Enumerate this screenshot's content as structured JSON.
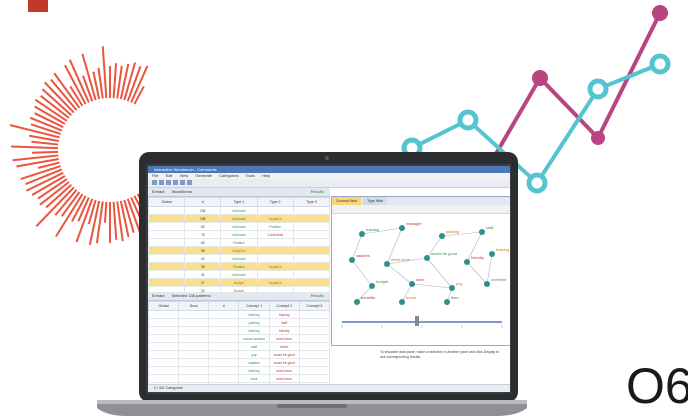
{
  "colors": {
    "accent_red": "#e9553f",
    "magenta": "#b8457f",
    "teal": "#55c4d1",
    "dash_yellow": "#f3c343",
    "corner_red": "#c0392b"
  },
  "icons": [
    "sunburst-graphic",
    "trend-line-graphic",
    "laptop-icon"
  ],
  "headline_fragment": "O6",
  "app": {
    "title": "Interactive Workbench - Comments",
    "menu": [
      "File",
      "Edit",
      "View",
      "Generate",
      "Categories",
      "Tools",
      "Help"
    ],
    "top_panel": {
      "label": "Extract",
      "field": "Word/Items",
      "run": "Results"
    },
    "top_columns": [
      "Global",
      "#",
      "Type 1",
      "Type 2",
      "Type 3"
    ],
    "top_rows": [
      {
        "g": "",
        "n": "234",
        "t1": "Unknown",
        "t2": "",
        "t3": "",
        "hl": false
      },
      {
        "g": "",
        "n": "198",
        "t1": "Unknown",
        "t2": "Negative",
        "t3": "",
        "hl": true
      },
      {
        "g": "",
        "n": "92",
        "t1": "Unknown",
        "t2": "Positive",
        "t3": "",
        "hl": false
      },
      {
        "g": "",
        "n": "75",
        "t1": "Unknown",
        "t2": "Contextual",
        "t3": "",
        "hl": false
      },
      {
        "g": "",
        "n": "60",
        "t1": "Positive",
        "t2": "",
        "t3": "",
        "hl": false
      },
      {
        "g": "",
        "n": "55",
        "t1": "Negative",
        "t2": "",
        "t3": "",
        "hl": true
      },
      {
        "g": "",
        "n": "42",
        "t1": "Unknown",
        "t2": "",
        "t3": "",
        "hl": false
      },
      {
        "g": "",
        "n": "38",
        "t1": "Positive",
        "t2": "Negative",
        "t3": "",
        "hl": true
      },
      {
        "g": "",
        "n": "31",
        "t1": "Unknown",
        "t2": "",
        "t3": "",
        "hl": false
      },
      {
        "g": "",
        "n": "27",
        "t1": "Budget",
        "t2": "Negative",
        "t3": "",
        "hl": true
      },
      {
        "g": "",
        "n": "22",
        "t1": "Budget",
        "t2": "",
        "t3": "",
        "hl": false
      },
      {
        "g": "",
        "n": "19",
        "t1": "Positive",
        "t2": "",
        "t3": "",
        "hl": false
      }
    ],
    "bottom_panel": {
      "label": "Extract",
      "field": "Selected 136 patterns",
      "run": "Results"
    },
    "bottom_columns": [
      "Global",
      "Docs",
      "#",
      "Concept 1",
      "Concept 2",
      "Concept 3"
    ],
    "bottom_rows": [
      {
        "c1": "training",
        "c2": "helping"
      },
      {
        "c1": "parking",
        "c2": "staff"
      },
      {
        "c1": "training",
        "c2": "friendly"
      },
      {
        "c1": "course session",
        "c2": "need more"
      },
      {
        "c1": "staff",
        "c2": "friend"
      },
      {
        "c1": "pay",
        "c2": "would be good"
      },
      {
        "c1": "salaries",
        "c2": "would be good"
      },
      {
        "c1": "training",
        "c2": "need more"
      },
      {
        "c1": "work",
        "c2": "need more"
      },
      {
        "c1": "pay",
        "c2": "would be good"
      },
      {
        "c1": "parking lots",
        "c2": "bad"
      },
      {
        "c1": "base",
        "c2": "too much"
      }
    ],
    "graph_tabs": [
      "Concept Web",
      "Type Web"
    ],
    "graph_nodes": [
      "training",
      "manager",
      "parking",
      "staff",
      "salaries",
      "need more",
      "would be good",
      "friendly",
      "helping",
      "budget",
      "work",
      "pay",
      "overtime",
      "benefits",
      "hours",
      "time"
    ],
    "hint": "To visualize data pane, make a selection in another pane and click Display to see corresponding results.",
    "status": "0 / 421 Categories"
  }
}
